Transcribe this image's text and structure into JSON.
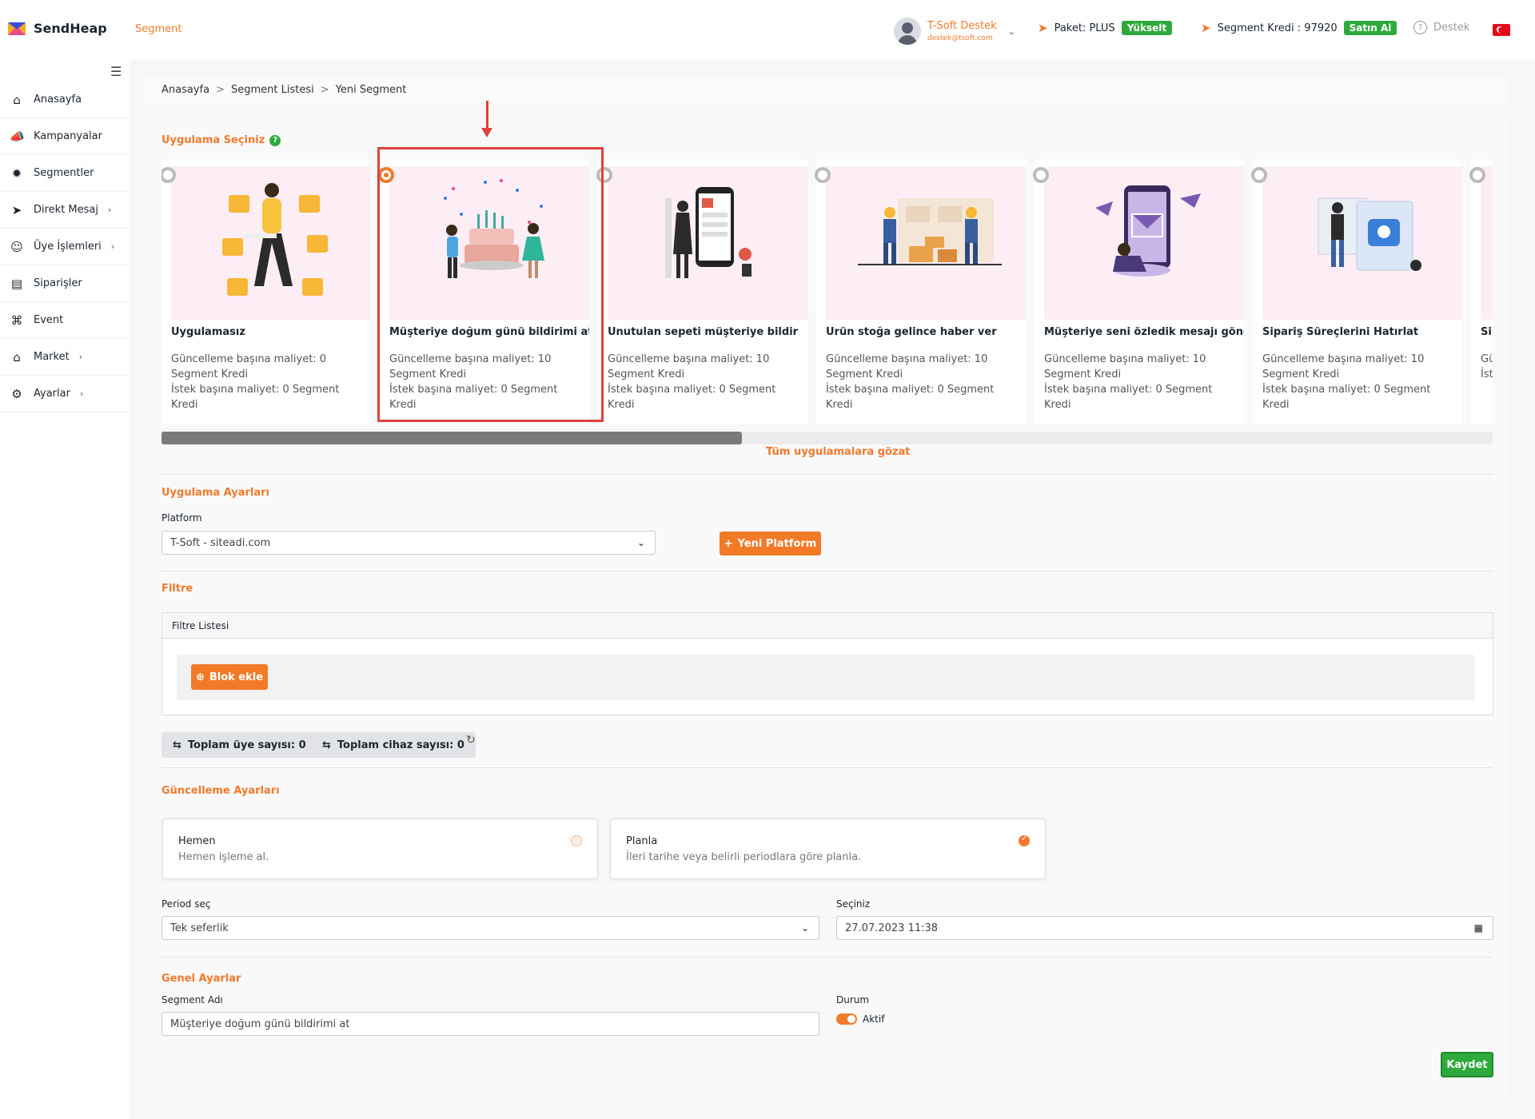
{
  "header": {
    "brand": "SendHeap",
    "page_label": "Segment",
    "user": {
      "name": "T-Soft Destek",
      "email": "destek@tsoft.com"
    },
    "package_label": "Paket: PLUS",
    "upgrade_label": "Yükselt",
    "credit_label": "Segment Kredi : 97920",
    "buy_label": "Satın Al",
    "support_label": "Destek"
  },
  "sidebar": {
    "items": [
      {
        "label": "Anasayfa",
        "icon": "home-icon",
        "chevron": false
      },
      {
        "label": "Kampanyalar",
        "icon": "megaphone-icon",
        "chevron": false
      },
      {
        "label": "Segmentler",
        "icon": "nodes-icon",
        "chevron": false
      },
      {
        "label": "Direkt Mesaj",
        "icon": "paper-plane-icon",
        "chevron": true
      },
      {
        "label": "Üye İşlemleri",
        "icon": "users-icon",
        "chevron": true
      },
      {
        "label": "Siparişler",
        "icon": "cart-icon",
        "chevron": false
      },
      {
        "label": "Event",
        "icon": "command-icon",
        "chevron": false
      },
      {
        "label": "Market",
        "icon": "store-icon",
        "chevron": true
      },
      {
        "label": "Ayarlar",
        "icon": "gear-icon",
        "chevron": true
      }
    ]
  },
  "breadcrumb": {
    "items": [
      "Anasayfa",
      "Segment Listesi",
      "Yeni Segment"
    ],
    "separator": ">"
  },
  "app_select": {
    "title": "Uygulama Seçiniz",
    "selected_index": 1,
    "apps": [
      {
        "title": "Uygulamasız",
        "update_cost": "Güncelleme başına maliyet: 0 Segment Kredi",
        "request_cost": "İstek başına maliyet: 0 Segment Kredi"
      },
      {
        "title": "Müşteriye doğum günü bildirimi at",
        "update_cost": "Güncelleme başına maliyet: 10 Segment Kredi",
        "request_cost": "İstek başına maliyet: 0 Segment Kredi"
      },
      {
        "title": "Unutulan sepeti müşteriye bildir",
        "update_cost": "Güncelleme başına maliyet: 10 Segment Kredi",
        "request_cost": "İstek başına maliyet: 0 Segment Kredi"
      },
      {
        "title": "Ürün stoğa gelince haber ver",
        "update_cost": "Güncelleme başına maliyet: 10 Segment Kredi",
        "request_cost": "İstek başına maliyet: 0 Segment Kredi"
      },
      {
        "title": "Müşteriye seni özledik mesajı gönder",
        "update_cost": "Güncelleme başına maliyet: 10 Segment Kredi",
        "request_cost": "İstek başına maliyet: 0 Segment Kredi"
      },
      {
        "title": "Sipariş Süreçlerini Hatırlat",
        "update_cost": "Güncelleme başına maliyet: 10 Segment Kredi",
        "request_cost": "İstek başına maliyet: 0 Segment Kredi"
      },
      {
        "title": "Sip",
        "update_cost": "Gü Kr",
        "request_cost": "İst"
      }
    ],
    "browse_all": "Tüm uygulamalara gözat"
  },
  "app_settings": {
    "title": "Uygulama Ayarları",
    "platform_label": "Platform",
    "platform_value": "T-Soft - siteadi.com",
    "new_platform_label": "Yeni Platform"
  },
  "filter": {
    "title": "Filtre",
    "list_header": "Filtre Listesi",
    "add_block_label": "Blok ekle",
    "total_members": "Toplam üye sayısı: 0",
    "total_devices": "Toplam cihaz sayısı: 0"
  },
  "update_settings": {
    "title": "Güncelleme Ayarları",
    "options": [
      {
        "title": "Hemen",
        "desc": "Hemen işleme al.",
        "selected": false
      },
      {
        "title": "Planla",
        "desc": "İleri tarihe veya belirli periodlara göre planla.",
        "selected": true
      }
    ],
    "period_label": "Period seç",
    "period_value": "Tek seferlik",
    "date_label": "Seçiniz",
    "date_value": "27.07.2023 11:38"
  },
  "general": {
    "title": "Genel Ayarlar",
    "name_label": "Segment Adı",
    "name_value": "Müşteriye doğum günü bildirimi at",
    "status_label": "Durum",
    "status_value": "Aktif",
    "save_label": "Kaydet"
  },
  "colors": {
    "accent": "#f07a2c",
    "success": "#2eaa3c",
    "highlight": "#e0413d",
    "card_bg": "#fdeef6"
  }
}
